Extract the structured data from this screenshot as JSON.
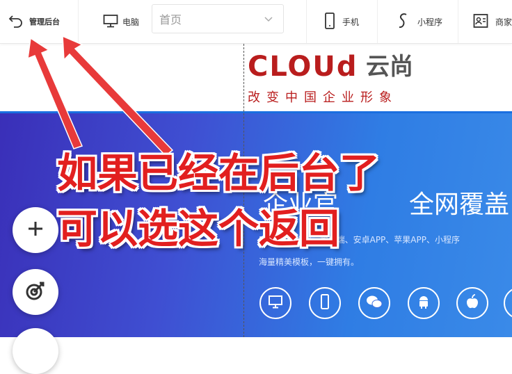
{
  "toolbar": {
    "back_label": "管理后台",
    "pc_label": "电脑",
    "page_select_value": "首页",
    "phone_label": "手机",
    "mini_label": "小程序",
    "biz_label": "商家"
  },
  "logo": {
    "word": "CLOUd",
    "cn": "云尚",
    "slogan": "改变中国企业形象"
  },
  "banner": {
    "hero_left": "企业官",
    "hero_right": "全网覆盖",
    "subtitle": "PC端、手机端、微信端、安卓APP、苹果APP、小程序",
    "subtitle2": "海量精美模板，一键拥有。",
    "platform_icons": [
      "desktop-icon",
      "phone-icon",
      "wechat-icon",
      "android-icon",
      "apple-icon",
      "more-icon"
    ]
  },
  "fabs": [
    "plus-icon",
    "target-icon",
    "other-icon"
  ],
  "annotation": {
    "line1": "如果已经在后台了",
    "line2": "可以选这个返回",
    "color": "#e21f1f"
  },
  "colors": {
    "brand_red": "#b91d1d",
    "banner_start": "#3a2fb8",
    "banner_end": "#3a8ae8"
  }
}
